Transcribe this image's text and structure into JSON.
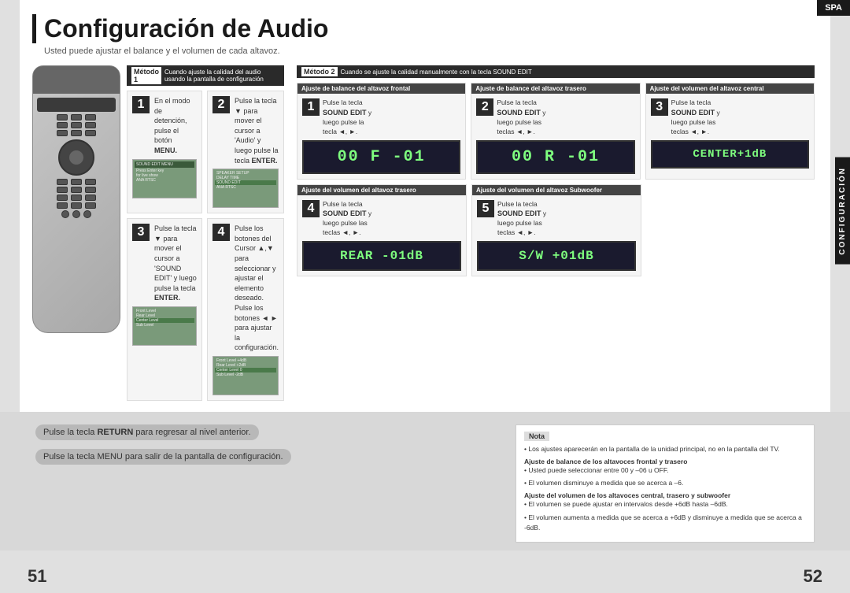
{
  "page": {
    "title": "Configuración de Audio",
    "subtitle": "Usted puede ajustar el balance y el volumen de cada altavoz.",
    "spa_label": "SPA",
    "config_label": "CONFIGURACIÓN",
    "page_num_left": "51",
    "page_num_right": "52"
  },
  "method1": {
    "label": "Método 1",
    "num_label": "1",
    "description": "Cuando ajuste la calidad del audio usando la pantalla de configuración",
    "step1": {
      "number": "1",
      "text": "En el modo de detención, pulse el botón MENU."
    },
    "step2": {
      "number": "2",
      "text": "Pulse la tecla ▼ para mover el cursor a 'Audio' y luego pulse la tecla ENTER."
    },
    "step3": {
      "number": "3",
      "text": "Pulse la tecla ▼ para mover el cursor a 'SOUND EDIT' y luego pulse la tecla ENTER."
    },
    "step4": {
      "number": "4",
      "text": "Pulse los botones del Cursor ▲,▼ para seleccionar y ajustar el elemento deseado. Pulse los botones ◄ ► para ajustar la configuración."
    }
  },
  "method2": {
    "label": "Método 2",
    "num_label": "2",
    "description": "Cuando se ajuste la calidad manualmente con la tecla SOUND EDIT",
    "section1": {
      "title": "Ajuste de balance del altavoz frontal",
      "step_num": "1",
      "text_line1": "Pulse la tecla",
      "text_line2": "SOUND EDIT y",
      "text_line3": "luego pulse la",
      "text_line4": "tecla ◄, ►.",
      "display": "00 F  -01"
    },
    "section2": {
      "title": "Ajuste de balance del altavoz trasero",
      "step_num": "2",
      "text_line1": "Pulse la tecla",
      "text_line2": "SOUND EDIT y",
      "text_line3": "luego pulse las",
      "text_line4": "teclas ◄, ►.",
      "display": "00 R  -01"
    },
    "section3": {
      "title": "Ajuste del volumen del altavoz central",
      "step_num": "3",
      "text_line1": "Pulse la tecla",
      "text_line2": "SOUND EDIT y",
      "text_line3": "luego pulse las",
      "text_line4": "teclas ◄, ►.",
      "display": "CENTER+1dB"
    },
    "section4": {
      "title": "Ajuste del volumen del altavoz trasero",
      "step_num": "4",
      "text_line1": "Pulse la tecla",
      "text_line2": "SOUND EDIT y",
      "text_line3": "luego pulse las",
      "text_line4": "teclas ◄, ►.",
      "display": "REAR  -01dB"
    },
    "section5": {
      "title": "Ajuste del volumen del altavoz Subwoofer",
      "step_num": "5",
      "text_line1": "Pulse la tecla",
      "text_line2": "SOUND EDIT y",
      "text_line3": "luego pulse las",
      "text_line4": "teclas ◄, ►.",
      "display": "S/W  +01dB"
    }
  },
  "bottom": {
    "return_line1": "Pulse la tecla RETURN para regresar al nivel anterior.",
    "return_line2": "Pulse la tecla MENU para salir de la pantalla de configuración.",
    "nota_title": "Nota",
    "nota_bullet1": "Los ajustes aparecerán en la pantalla de la unidad principal, no en la pantalla del TV.",
    "nota_sub1_title": "Ajuste de balance de los altavoces frontal y trasero",
    "nota_sub1_text1": "• Usted puede seleccionar entre 00 y –06 u OFF.",
    "nota_sub1_text2": "• El volumen disminuye a medida que se acerca a –6.",
    "nota_sub2_title": "Ajuste del volumen de los altavoces central, trasero y subwoofer",
    "nota_sub2_text1": "• El volumen se puede ajustar en intervalos desde +6dB hasta –6dB.",
    "nota_sub2_text2": "• El volumen aumenta a medida que se acerca a +6dB y disminuye a medida que se acerca a -6dB."
  }
}
